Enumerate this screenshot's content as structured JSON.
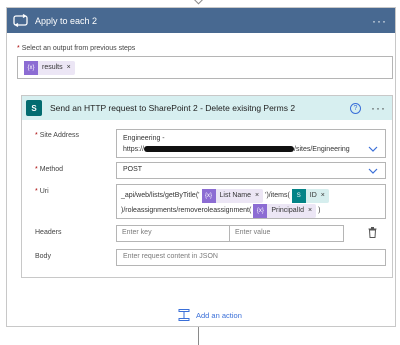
{
  "loop": {
    "title": "Apply to each 2",
    "menu_icon": "ellipsis-icon",
    "prev_steps_label": "Select an output from previous steps",
    "prev_steps_required": "*",
    "prev_token": "results"
  },
  "action": {
    "title": "Send an HTTP request to SharePoint 2 - Delete exisitng Perms 2",
    "help_glyph": "?",
    "site": {
      "label": "Site Address",
      "line1": "Engineering -",
      "line2_prefix": "https://",
      "line2_suffix": "/sites/Engineering"
    },
    "method": {
      "label": "Method",
      "value": "POST"
    },
    "uri": {
      "label": "Uri",
      "seg1": "_api/web/lists/getByTitle('",
      "token1": "List Name",
      "seg2": "')/items(",
      "token2": "ID",
      "seg3": ")/roleassignments/removeroleassignment(",
      "token3": "PrincipalId",
      "seg4": ")"
    },
    "headers": {
      "label": "Headers",
      "key_placeholder": "Enter key",
      "value_placeholder": "Enter value"
    },
    "body": {
      "label": "Body",
      "placeholder": "Enter request content in JSON"
    }
  },
  "add_action_label": "Add an action",
  "required_mark": "*",
  "token_close": "×",
  "colors": {
    "loop_header": "#486991",
    "action_header": "#d7eff0",
    "sharepoint": "#036c70",
    "variable_token": "#8c6cd3",
    "link": "#3a6fd8"
  }
}
